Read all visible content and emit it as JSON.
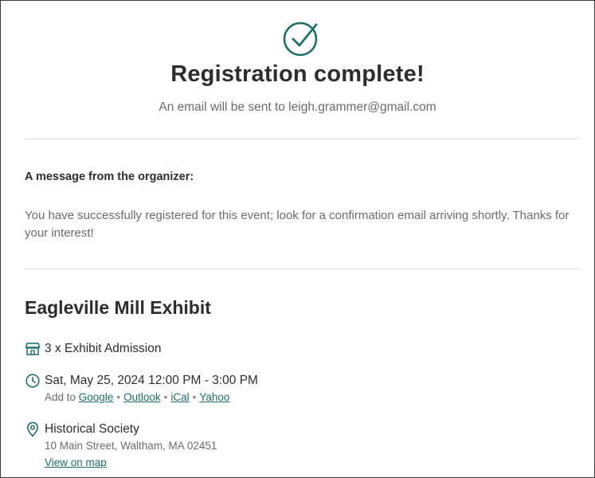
{
  "confirmation": {
    "title": "Registration complete!",
    "email_notice": "An email will be sent to leigh.grammer@gmail.com"
  },
  "organizer_message": {
    "heading": "A message from the organizer:",
    "body": "You have successfully registered for this event; look for a confirmation email arriving shortly. Thanks for your interest!"
  },
  "event": {
    "title": "Eagleville Mill Exhibit",
    "tickets": "3 x Exhibit Admission",
    "datetime": "Sat, May 25, 2024 12:00 PM - 3:00 PM",
    "add_to_label": "Add to",
    "calendar_links": {
      "google": "Google",
      "outlook": "Outlook",
      "ical": "iCal",
      "yahoo": "Yahoo"
    },
    "location_name": "Historical Society",
    "address": "10 Main Street, Waltham, MA 02451",
    "map_link": "View on map"
  },
  "icons": {
    "check": "check-circle-icon",
    "ticket": "storefront-icon",
    "time": "clock-icon",
    "location": "map-pin-icon"
  },
  "colors": {
    "accent": "#1c6e6a",
    "title_text": "#2d2d2d",
    "muted_text": "#6b6b6b",
    "divider": "#dcdcdc"
  }
}
